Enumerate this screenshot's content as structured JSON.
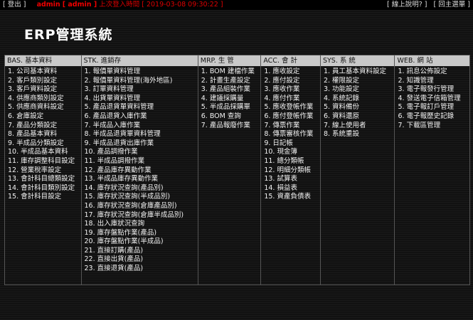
{
  "topbar": {
    "logout": "[ 登出 ]",
    "user": "admin",
    "user_id": "[ admin ]",
    "last_login": "上次登入時間 [ 2019-03-08 09:30:22 ]",
    "help": "[ 線上說明? ]",
    "main_menu": "[ 回主選單 ]"
  },
  "title": "ERP管理系統",
  "columns": [
    {
      "header": "BAS. 基本資料",
      "items": [
        "1. 公司基本資料",
        "2. 客戶類別設定",
        "3. 客戶資料設定",
        "4. 供應商類別設定",
        "5. 供應商資料設定",
        "6. 倉庫設定",
        "7. 產品分類設定",
        "8. 產品基本資料",
        "9. 半成品分類設定",
        "10. 半成品基本資料",
        "11. 庫存調整科目設定",
        "12. 營業稅率設定",
        "13. 會計科目總類設定",
        "14. 會計科目類別設定",
        "15. 會計科目設定"
      ]
    },
    {
      "header": "STK. 進銷存",
      "items": [
        "1. 報價單資料管理",
        "2. 報價單資料管理(海外地區)",
        "3. 訂單資料管理",
        "4. 出貨單資料管理",
        "5. 產品退貨單資料管理",
        "6. 產品退貨入庫作業",
        "7. 半成品入庫作業",
        "8. 半成品退貨單資料管理",
        "9. 半成品退貨出庫作業",
        "10. 產品調撥作業",
        "11. 半成品調撥作業",
        "12. 產品庫存異動作業",
        "13. 半成品庫存異動作業",
        "14. 庫存狀況查詢(產品別)",
        "15. 庫存狀況查詢(半成品別)",
        "16. 庫存狀況查詢(倉庫產品別)",
        "17. 庫存狀況查詢(倉庫半成品別)",
        "18. 出入庫狀況查詢",
        "19. 庫存盤點作業(產品)",
        "20. 庫存盤點作業(半成品)",
        "21. 直接訂購(產品)",
        "22. 直接出貨(產品)",
        "23. 直接退貨(產品)"
      ]
    },
    {
      "header": "MRP. 生 管",
      "items": [
        "1. BOM 建檔作業",
        "2. 計畫生產設定",
        "3. 產品組裝作業",
        "4. 建議採購量",
        "5. 半成品採購單",
        "6. BOM 查詢",
        "7. 產品報廢作業"
      ]
    },
    {
      "header": "ACC. 會 計",
      "items": [
        "1. 應收設定",
        "2. 應付設定",
        "3. 應收作業",
        "4. 應付作業",
        "5. 應收登帳作業",
        "6. 應付登帳作業",
        "7. 傳票作業",
        "8. 傳票審核作業",
        "9. 日記帳",
        "10. 現金簿",
        "11. 總分類帳",
        "12. 明細分類帳",
        "13. 試算表",
        "14. 損益表",
        "15. 資產負債表"
      ]
    },
    {
      "header": "SYS. 系 統",
      "items": [
        "1. 員工基本資料設定",
        "2. 權限設定",
        "3. 功能設定",
        "4. 系統記錄",
        "5. 資料備份",
        "6. 資料還原",
        "7. 線上使用者",
        "8. 系統重設"
      ]
    },
    {
      "header": "WEB. 網 站",
      "items": [
        "1. 訊息公佈設定",
        "2. 知識管理",
        "3. 電子報發行管理",
        "4. 發送電子信箱管理",
        "5. 電子報訂戶管理",
        "6. 電子報歷史記錄",
        "7. 下載區管理"
      ]
    }
  ]
}
